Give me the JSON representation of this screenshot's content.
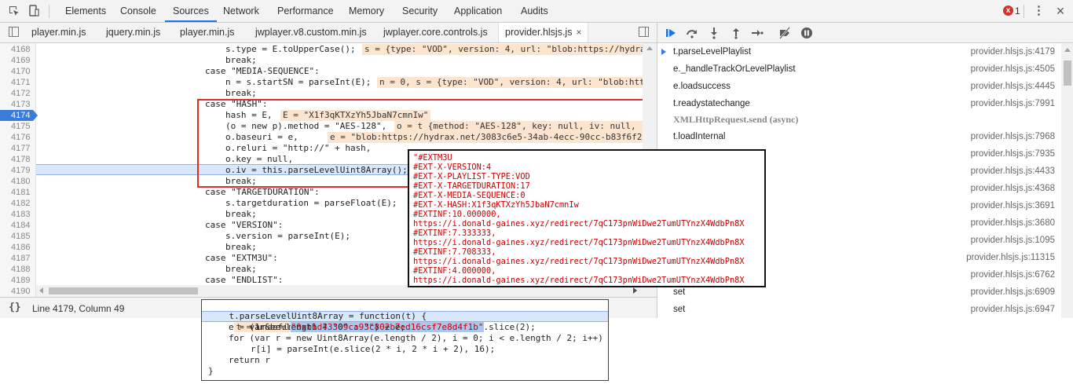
{
  "toolbar": {
    "tabs": [
      "Elements",
      "Console",
      "Sources",
      "Network",
      "Performance",
      "Memory",
      "Security",
      "Application",
      "Audits"
    ],
    "active_tab": "Sources",
    "error_count": "1",
    "error_icon": "x",
    "kebab_icon": "⋮",
    "close_icon": "×"
  },
  "file_tabs": {
    "files": [
      "player.min.js",
      "jquery.min.js",
      "player.min.js",
      "jwplayer.v8.custom.min.js",
      "jwplayer.core.controls.js",
      "provider.hlsjs.js"
    ],
    "active_file": "provider.hlsjs.js",
    "close_glyph": "×"
  },
  "editor": {
    "line_numbers": [
      "4168",
      "4169",
      "4170",
      "4171",
      "4172",
      "4173",
      "4174",
      "4175",
      "4176",
      "4177",
      "4178",
      "4179",
      "4180",
      "4181",
      "4182",
      "4183",
      "4184",
      "4185",
      "4186",
      "4187",
      "4188",
      "4189",
      "4190"
    ],
    "current_line": "4174",
    "code_lines": [
      "s.type = E.toUpperCase();",
      "break;",
      "case \"MEDIA-SEQUENCE\":",
      "n = s.startSN = parseInt(E);",
      "break;",
      "case \"HASH\":",
      "hash = E,",
      "(o = new p).method = \"AES-128\",",
      "o.baseuri = e,",
      "o.reluri = \"http://\" + hash,",
      "o.key = null,",
      "o.iv = this.parseLevelUint8Array();",
      "break;",
      "case \"TARGETDURATION\":",
      "s.targetduration = parseFloat(E);",
      "break;",
      "case \"VERSION\":",
      "s.version = parseInt(E);",
      "break;",
      "case \"EXTM3U\":",
      "break;",
      "case \"ENDLIST\":",
      ""
    ],
    "inline_values": {
      "l4168": "s = {type: \"VOD\", version: 4, url: \"blob:https://hydra",
      "l4171": "n = 0, s = {type: \"VOD\", version: 4, url: \"blob:htt",
      "l4174": "E = \"X1f3qKTXzYh5JbaN7cmnIw\"",
      "l4175": "o = t {method: \"AES-128\", key: null, iv: null, ",
      "l4176": "e = \"blob:https://hydrax.net/3083c6e5-34ab-4ecc-90cc-b83f6f2a02e"
    }
  },
  "status": {
    "braces": "{}",
    "cursor": "Line 4179, Column 49"
  },
  "debugger": {
    "controls": [
      "resume-icon",
      "step-over-icon",
      "step-into-icon",
      "step-out-icon",
      "step-icon",
      "deactivate-breakpoints-icon",
      "pause-on-exceptions-icon"
    ],
    "frames": [
      {
        "fn": "t.parseLevelPlaylist",
        "loc": "provider.hlsjs.js:4179"
      },
      {
        "fn": "e._handleTrackOrLevelPlaylist",
        "loc": "provider.hlsjs.js:4505"
      },
      {
        "fn": "e.loadsuccess",
        "loc": "provider.hlsjs.js:4445"
      },
      {
        "fn": "t.readystatechange",
        "loc": "provider.hlsjs.js:7991"
      },
      {
        "fn": "t.loadInternal",
        "loc": "provider.hlsjs.js:7968"
      },
      {
        "fn": "",
        "loc": "provider.hlsjs.js:7935"
      },
      {
        "fn": "",
        "loc": "provider.hlsjs.js:4433"
      },
      {
        "fn": "",
        "loc": "provider.hlsjs.js:4368"
      },
      {
        "fn": "",
        "loc": "provider.hlsjs.js:3691"
      },
      {
        "fn": "",
        "loc": "provider.hlsjs.js:3680"
      },
      {
        "fn": "",
        "loc": "provider.hlsjs.js:1095"
      },
      {
        "fn": "",
        "loc": "provider.hlsjs.js:11315"
      },
      {
        "fn": "",
        "loc": "provider.hlsjs.js:6762"
      },
      {
        "fn": "set",
        "loc": "provider.hlsjs.js:6909"
      },
      {
        "fn": "set",
        "loc": "provider.hlsjs.js:6947"
      }
    ],
    "async_separator": "XMLHttpRequest.send (async)"
  },
  "playlist_popover": {
    "lines": [
      "\"#EXTM3U",
      "#EXT-X-VERSION:4",
      "#EXT-X-PLAYLIST-TYPE:VOD",
      "#EXT-X-TARGETDURATION:17",
      "#EXT-X-MEDIA-SEQUENCE:0",
      "#EXT-X-HASH:X1f3qKTXzYh5JbaN7cmnIw",
      "#EXTINF:10.000000,",
      "https://i.donald-gaines.xyz/redirect/7qC173pnWiDwe2TumUTYnzX4WdbPn8X",
      "#EXTINF:7.333333,",
      "https://i.donald-gaines.xyz/redirect/7qC173pnWiDwe2TumUTYnzX4WdbPn8X",
      "#EXTINF:7.708333,",
      "https://i.donald-gaines.xyz/redirect/7qC173pnWiDwe2TumUTYnzX4WdbPn8X",
      "#EXTINF:4.000000,",
      "https://i.donald-gaines.xyz/redirect/7qC173pnWiDwe2TumUTYnzX4WdbPn8X"
    ]
  },
  "function_popover": {
    "header": "t.parseLevelUint8Array = function(t) {",
    "header_value": "t = undefined",
    "var_prefix": "var e = ",
    "hex_string": "\"0xb1d43309ca93c802b7ed16csf7e8d4f1b\"",
    "var_suffix": ".slice(2);",
    "lines": [
      "e = (1 & e.length ? \"0\" : \"\") + e;",
      "for (var r = new Uint8Array(e.length / 2), i = 0; i < e.length / 2; i++)",
      "r[i] = parseInt(e.slice(2 * i, 2 * i + 2), 16);",
      "return r",
      "}"
    ]
  }
}
